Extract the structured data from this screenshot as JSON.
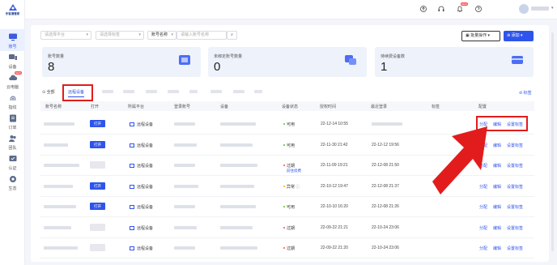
{
  "brand": {
    "name": "乐客通管家"
  },
  "sidebar": {
    "items": [
      {
        "label": "账号",
        "active": true,
        "icon": "monitor-icon"
      },
      {
        "label": "设备",
        "icon": "devices-icon"
      },
      {
        "label": "云电脑",
        "icon": "cloud-icon",
        "badge": "NEW"
      },
      {
        "label": "指纹",
        "icon": "fingerprint-icon"
      },
      {
        "label": "订单",
        "icon": "order-icon"
      },
      {
        "label": "团队",
        "icon": "team-icon"
      },
      {
        "label": "认证",
        "icon": "verify-icon"
      },
      {
        "label": "生态",
        "icon": "ecology-icon"
      }
    ]
  },
  "topbar": {
    "message_badge": "NEW"
  },
  "filters": {
    "platform_placeholder": "请选择平台",
    "tag_placeholder": "请选择标签",
    "account_name_label": "账号名称",
    "search_placeholder": "请输入账号名称",
    "batch_label": "批量操作",
    "add_label": "添加"
  },
  "stats": [
    {
      "title": "账号数量",
      "value": "8"
    },
    {
      "title": "未绑定账号数量",
      "value": "0"
    },
    {
      "title": "待续费设备数",
      "value": "1"
    }
  ],
  "tabs": {
    "all": "全部",
    "remote": "远程设备",
    "tag_link": "标签"
  },
  "table": {
    "headers": [
      "账号名称",
      "打开",
      "所属平台",
      "登录账号",
      "设备",
      "设备状态",
      "授权时间",
      "最近登录",
      "标签",
      "配置"
    ],
    "open_label": "打开",
    "actions": [
      "分配",
      "编辑",
      "设置标签"
    ],
    "rows": [
      {
        "open": true,
        "platform": "远程设备",
        "status": "可用",
        "status_color": "#52c41a",
        "sub": "",
        "auth": "22-12-14 10:55",
        "last": ""
      },
      {
        "open": true,
        "platform": "远程设备",
        "status": "可用",
        "status_color": "#52c41a",
        "sub": "",
        "auth": "22-11-30 21:42",
        "last": "22-12-12 19:56"
      },
      {
        "open": false,
        "platform": "远程设备",
        "status": "过期",
        "status_color": "#ff4d4f",
        "sub": "前往续费",
        "auth": "22-11-09 19:21",
        "last": "22-12-08 21:50"
      },
      {
        "open": true,
        "platform": "远程设备",
        "status": "异常",
        "status_color": "#faad14",
        "sub": "",
        "auth": "22-10-12 19:47",
        "last": "22-12-08 21:37"
      },
      {
        "open": true,
        "platform": "远程设备",
        "status": "可用",
        "status_color": "#52c41a",
        "sub": "",
        "auth": "22-10-10 16:20",
        "last": "22-12-08 21:26"
      },
      {
        "open": false,
        "platform": "远程设备",
        "status": "过期",
        "status_color": "#ff4d4f",
        "sub": "",
        "auth": "22-09-22 21:21",
        "last": "22-10-24 23:06"
      },
      {
        "open": false,
        "platform": "远程设备",
        "status": "过期",
        "status_color": "#ff4d4f",
        "sub": "",
        "auth": "22-09-22 21:20",
        "last": "22-10-24 23:06"
      }
    ]
  },
  "colors": {
    "accent": "#2f54eb",
    "highlight": "#e21c1c"
  }
}
